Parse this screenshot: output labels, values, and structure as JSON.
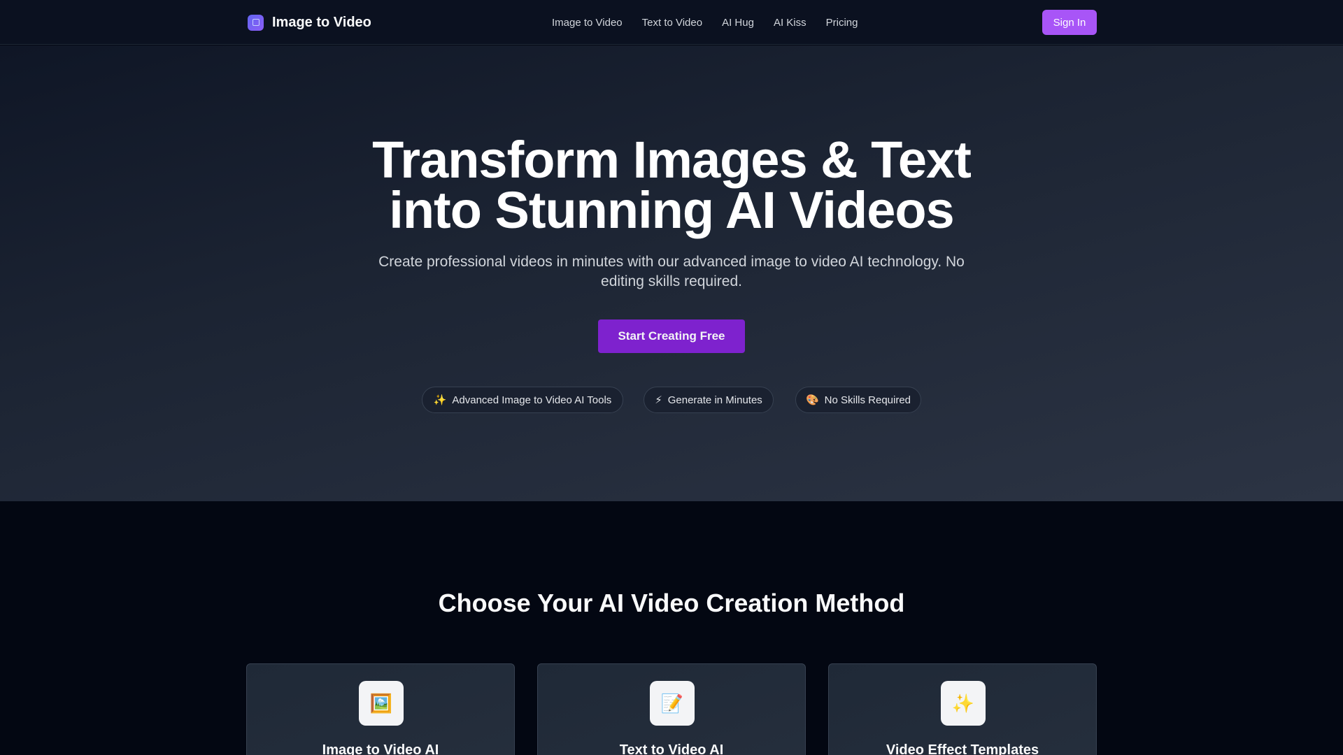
{
  "header": {
    "brand_name": "Image to Video",
    "brand_icon": "video-square-icon",
    "nav": [
      {
        "label": "Image to Video"
      },
      {
        "label": "Text to Video"
      },
      {
        "label": "AI Hug"
      },
      {
        "label": "AI Kiss"
      },
      {
        "label": "Pricing"
      }
    ],
    "signin_label": "Sign In"
  },
  "hero": {
    "title_line1": "Transform Images & Text",
    "title_line2": "into Stunning AI Videos",
    "subtitle": "Create professional videos in minutes with our advanced image to video AI technology. No editing skills required.",
    "cta_label": "Start Creating Free",
    "pills": [
      {
        "icon": "✨",
        "icon_name": "sparkles-icon",
        "label": "Advanced Image to Video AI Tools"
      },
      {
        "icon": "⚡",
        "icon_name": "lightning-icon",
        "label": "Generate in Minutes"
      },
      {
        "icon": "🎨",
        "icon_name": "palette-icon",
        "label": "No Skills Required"
      }
    ]
  },
  "methods": {
    "title": "Choose Your AI Video Creation Method",
    "cards": [
      {
        "icon": "🖼️",
        "icon_name": "image-icon",
        "title": "Image to Video AI"
      },
      {
        "icon": "📝",
        "icon_name": "memo-icon",
        "title": "Text to Video AI"
      },
      {
        "icon": "✨",
        "icon_name": "sparkles-icon",
        "title": "Video Effect Templates"
      }
    ]
  },
  "colors": {
    "accent": "#a855f7",
    "cta": "#7e22ce",
    "background": "#030712",
    "header": "#0b1120"
  }
}
